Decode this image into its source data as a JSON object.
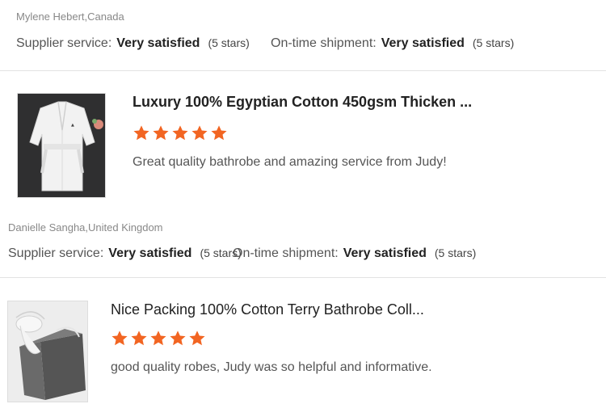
{
  "colors": {
    "star": "#f26522",
    "divider": "#e3e3e3",
    "muted": "#888888"
  },
  "reviews": [
    {
      "reviewer": "Mylene Hebert,Canada",
      "supplier_label": "Supplier service:",
      "supplier_value": "Very satisfied",
      "supplier_stars": "(5 stars)",
      "shipment_label": "On-time shipment:",
      "shipment_value": "Very satisfied",
      "shipment_stars": "(5 stars)"
    },
    {
      "product_title": "Luxury 100% Egyptian Cotton 450gsm Thicken ...",
      "rating": 5,
      "comment": "Great quality bathrobe and amazing service from Judy!",
      "reviewer": "Danielle Sangha,United Kingdom",
      "supplier_label": "Supplier service:",
      "supplier_value": "Very satisfied",
      "supplier_stars": "(5 stars)",
      "shipment_label": "On-time shipment:",
      "shipment_value": "Very satisfied",
      "shipment_stars": "(5 stars)"
    },
    {
      "product_title": "Nice Packing 100% Cotton Terry Bathrobe Coll...",
      "rating": 5,
      "comment": "good quality robes, Judy was so helpful and informative."
    }
  ]
}
